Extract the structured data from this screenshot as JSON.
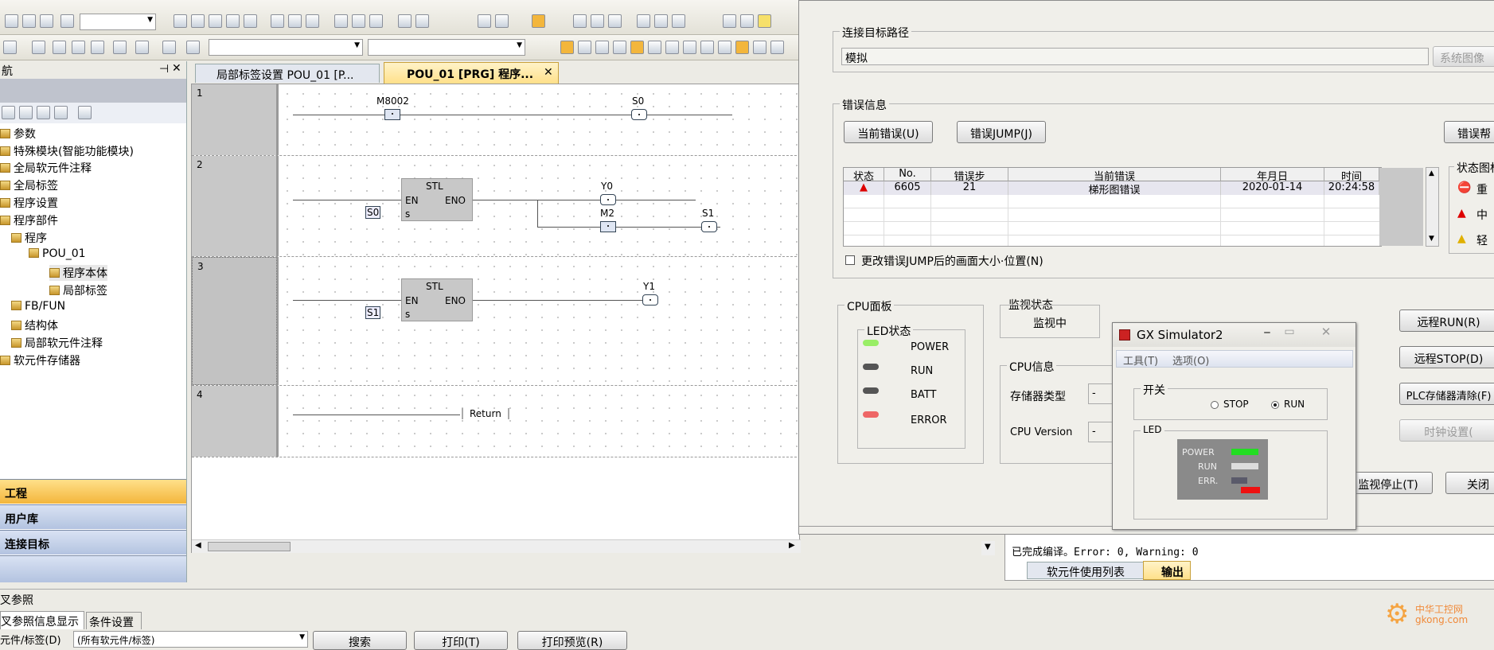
{
  "toolbar": {
    "combo1": "",
    "combo2": "",
    "combo3": ""
  },
  "nav": {
    "title": "航",
    "items": [
      "参数",
      "特殊模块(智能功能模块)",
      "全局软元件注释",
      "全局标签",
      "程序设置",
      "程序部件",
      "程序",
      "POU_01",
      "程序本体",
      "局部标签",
      "FB/FUN",
      "结构体",
      "局部软元件注释",
      "软元件存储器"
    ],
    "buttons": [
      "工程",
      "用户库",
      "连接目标"
    ]
  },
  "tabs": [
    "局部标签设置 POU_01 [P...",
    "POU_01 [PRG] 程序..."
  ],
  "ladder": {
    "rungs": [
      "1",
      "2",
      "3",
      "4"
    ],
    "labels": {
      "m8002": "M8002",
      "s0": "S0",
      "stl": "STL",
      "en": "EN",
      "eno": "ENO",
      "s": "s",
      "y0": "Y0",
      "m2": "M2",
      "s1": "S1",
      "y1": "Y1",
      "ret": "Return"
    }
  },
  "bottom": {
    "title": "叉参照",
    "tabs": [
      "叉参照信息显示",
      "条件设置"
    ],
    "filter_label": "元件/标签(D)",
    "filter_value": "(所有软元件/标签)",
    "search": "搜索",
    "print": "打印(T)",
    "preview": "打印预览(R)"
  },
  "output": {
    "log": "已完成编译。Error: 0, Warning: 0",
    "tabs": [
      "软元件使用列表",
      "输出"
    ]
  },
  "plc": {
    "path_title": "连接目标路径",
    "path_value": "模拟",
    "sys_btn": "系统图像",
    "err_title": "错误信息",
    "cur_err_btn": "当前错误(U)",
    "jump_btn": "错误JUMP(J)",
    "help_btn": "错误帮",
    "headers": [
      "状态",
      "No.",
      "错误步",
      "当前错误",
      "年月日",
      "时间"
    ],
    "row": [
      "6605",
      "21",
      "梯形图错误",
      "2020-01-14",
      "20:24:58"
    ],
    "chk": "更改错误JUMP后的画面大小·位置(N)",
    "legend_title": "状态图标",
    "legend": [
      "重",
      "中",
      "轻"
    ],
    "cpu_panel": "CPU面板",
    "led_title": "LED状态",
    "leds": [
      "POWER",
      "RUN",
      "BATT",
      "ERROR"
    ],
    "mon_title": "监视状态",
    "mon_value": "监视中",
    "cpu_info": "CPU信息",
    "mem_type": "存储器类型",
    "cpu_ver": "CPU Version",
    "dash": "-",
    "remote_run": "远程RUN(R)",
    "remote_stop": "远程STOP(D)",
    "mem_clear": "PLC存储器清除(F)",
    "clock": "时钟设置(",
    "mon_stop": "监视停止(T)",
    "close": "关闭"
  },
  "sim": {
    "title": "GX Simulator2",
    "menu": [
      "工具(T)",
      "选项(O)"
    ],
    "switch_title": "开关",
    "stop": "STOP",
    "run": "RUN",
    "led_title": "LED",
    "leds": [
      "POWER",
      "RUN",
      "ERR."
    ]
  },
  "watermark": "中华工控网\ngkong.com",
  "colors": {
    "accent": "#f3b63c",
    "nav_btn": "#c5d2ea",
    "led_green": "#22dd22",
    "led_red": "#ee1111"
  }
}
